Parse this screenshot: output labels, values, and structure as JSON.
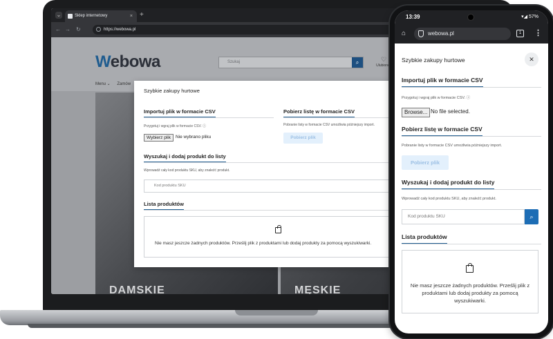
{
  "laptop": {
    "browser": {
      "tab_title": "Sklep internetowy",
      "tab_close": "×",
      "new_tab": "+",
      "url": "https://webowa.pl"
    },
    "site": {
      "logo_prefix": "W",
      "logo_rest": "ebowa",
      "search_placeholder": "Szukaj",
      "wishlist_label": "Ulubione",
      "menu_label": "Menu ⌄",
      "menu_item2": "Zamów",
      "hero_left": "DAMSKIE",
      "hero_right": "MĘSKIE"
    },
    "modal": {
      "title": "Szybkie zakupy hurtowe",
      "import_heading": "Importuj plik w formacie CSV",
      "import_hint": "Przygotuj i wgraj plik w formacie CSV.",
      "file_button": "Wybierz plik",
      "file_status": "Nie wybrano pliku",
      "download_heading": "Pobierz listę w formacie CSV",
      "download_hint": "Pobranie listy w formacie CSV umożliwia późniejszy import.",
      "download_button": "Pobierz plik",
      "search_heading": "Wyszukaj i dodaj produkt do listy",
      "search_hint": "Wprowadź cały kod produktu SKU, aby znaleźć produkt.",
      "sku_placeholder": "Kod produktu SKU",
      "list_heading": "Lista produktów",
      "empty_text": "Nie masz jeszcze żadnych produktów. Prześlij plik z produktami lub dodaj produkty za pomocą wyszukiwarki."
    }
  },
  "phone": {
    "status": {
      "time": "13:39",
      "battery": "▾◢ 57%"
    },
    "browser": {
      "url": "webowa.pl",
      "tab_count": "1",
      "kebab": "⋮"
    },
    "modal": {
      "title": "Szybkie zakupy hurtowe",
      "close": "✕",
      "import_heading": "Importuj plik w formacie CSV",
      "import_hint": "Przygotuj i wgraj plik w formacie CSV.",
      "file_button": "Browse...",
      "file_status": "No file selected.",
      "download_heading": "Pobierz listę w formacie CSV",
      "download_hint": "Pobranie listy w formacie CSV umożliwia późniejszy import.",
      "download_button": "Pobierz plik",
      "search_heading": "Wyszukaj i dodaj produkt do listy",
      "search_hint": "Wprowadź cały kod produktu SKU, aby znaleźć produkt.",
      "sku_placeholder": "Kod produktu SKU",
      "list_heading": "Lista produktów",
      "empty_text": "Nie masz jeszcze żadnych produktów. Prześlij plik z produktami lub dodaj produkty za pomocą wyszukiwarki."
    }
  },
  "colors": {
    "accent": "#1f5c8f",
    "button_disabled_bg": "#e3f0fc",
    "button_disabled_text": "#9bbfe4"
  }
}
